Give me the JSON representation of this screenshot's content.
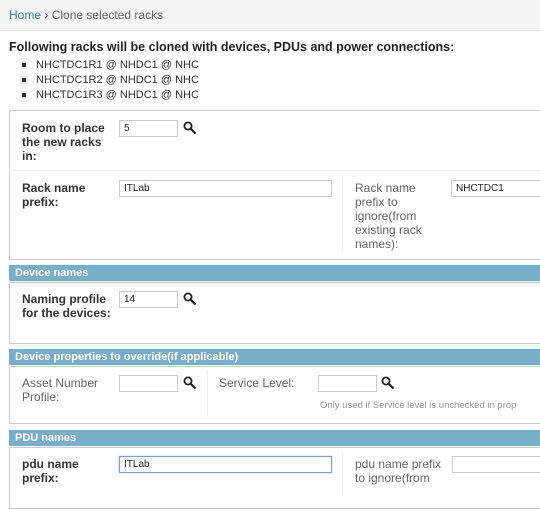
{
  "breadcrumbs": {
    "home": "Home",
    "separator": "›",
    "current": "Clone selected racks"
  },
  "intro": "Following racks will be cloned with devices, PDUs and power connections:",
  "racks": [
    "NHCTDC1R1 @ NHDC1 @ NHC",
    "NHCTDC1R2 @ NHDC1 @ NHC",
    "NHCTDC1R3 @ NHDC1 @ NHC"
  ],
  "general": {
    "room_label": "Room to place the new racks in:",
    "room_value": "5",
    "rack_prefix_label": "Rack name prefix:",
    "rack_prefix_value": "ITLab",
    "rack_ignore_label": "Rack name prefix to ignore(from existing rack names):",
    "rack_ignore_value": "NHCTDC1"
  },
  "device_names": {
    "title": "Device names",
    "naming_label": "Naming profile for the devices:",
    "naming_value": "14"
  },
  "device_props": {
    "title": "Device properties to override(if applicable)",
    "asset_label": "Asset Number Profile:",
    "asset_value": "",
    "service_label": "Service Level:",
    "service_value": "",
    "service_help": "Only used if Service level is unchecked in prop"
  },
  "pdu_names": {
    "title": "PDU names",
    "prefix_label": "pdu name prefix:",
    "prefix_value": "ITLab",
    "ignore_label": "pdu name prefix to ignore(from",
    "ignore_value": ""
  },
  "icons": {
    "lookup": "magnifier-icon"
  },
  "colors": {
    "section_header": "#79aec8",
    "link": "#447e9b"
  }
}
